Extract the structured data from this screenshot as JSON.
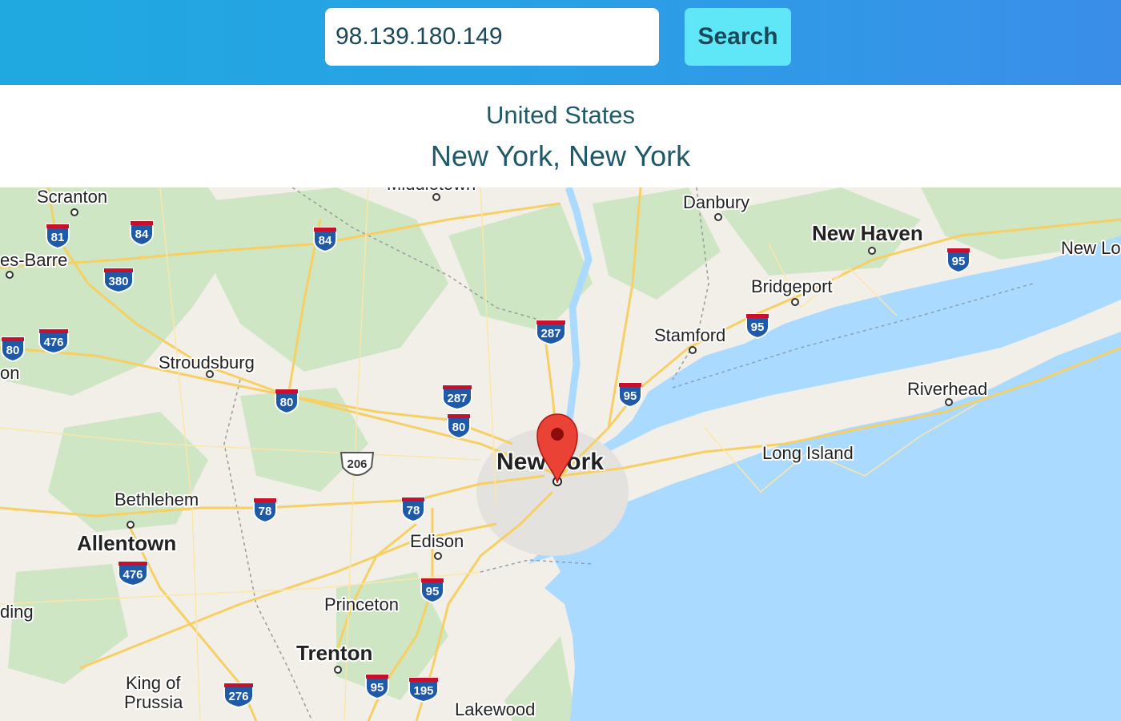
{
  "search": {
    "value": "98.139.180.149",
    "button_label": "Search"
  },
  "result": {
    "country": "United States",
    "location": "New York, New York"
  },
  "map": {
    "marker_icon": "map-pin-icon",
    "marker_color": "#ea4335",
    "water_color": "#aadaff",
    "land_color": "#f2efe9",
    "cities": [
      {
        "name": "Scranton"
      },
      {
        "name": "Middletown"
      },
      {
        "name": "Danbury"
      },
      {
        "name": "New Haven"
      },
      {
        "name": "New Lo"
      },
      {
        "name": "es-Barre"
      },
      {
        "name": "Bridgeport"
      },
      {
        "name": "Stamford"
      },
      {
        "name": "Stroudsburg"
      },
      {
        "name": "on"
      },
      {
        "name": "Riverhead"
      },
      {
        "name": "New York"
      },
      {
        "name": "Long Island"
      },
      {
        "name": "Bethlehem"
      },
      {
        "name": "Allentown"
      },
      {
        "name": "Edison"
      },
      {
        "name": "ding"
      },
      {
        "name": "Princeton"
      },
      {
        "name": "Trenton"
      },
      {
        "name": "King of"
      },
      {
        "name": "Prussia"
      },
      {
        "name": "Lakewood"
      }
    ],
    "interstate_shields": [
      "81",
      "84",
      "84",
      "380",
      "80",
      "476",
      "80",
      "287",
      "287",
      "80",
      "95",
      "95",
      "95",
      "78",
      "78",
      "476",
      "95",
      "276",
      "95",
      "195"
    ],
    "us_route_shields": [
      "206"
    ]
  }
}
